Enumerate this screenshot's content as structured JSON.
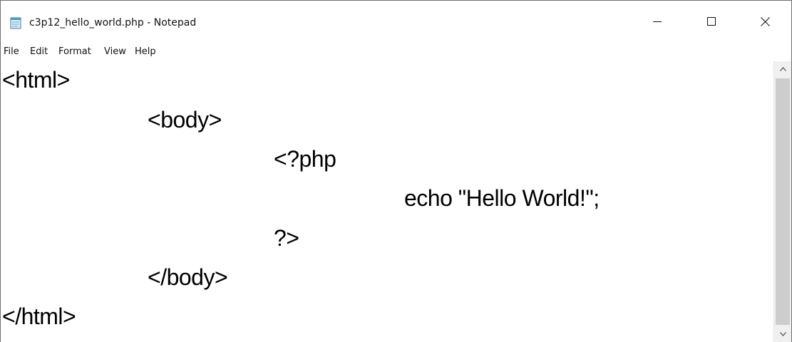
{
  "window": {
    "title": "c3p12_hello_world.php - Notepad",
    "controls": {
      "minimize_icon": "minimize-icon",
      "maximize_icon": "maximize-icon",
      "close_icon": "close-icon"
    }
  },
  "menu": {
    "items": [
      "File",
      "Edit",
      "Format",
      "View",
      "Help"
    ]
  },
  "editor": {
    "lines": [
      "<html>",
      "<body>",
      "<?php",
      "echo \"Hello World!\";",
      "?>",
      "</body>",
      "</html>"
    ]
  },
  "colors": {
    "text": "#000000",
    "scrollbar_track": "#f0f0f0",
    "scrollbar_thumb": "#cdcdcd"
  }
}
